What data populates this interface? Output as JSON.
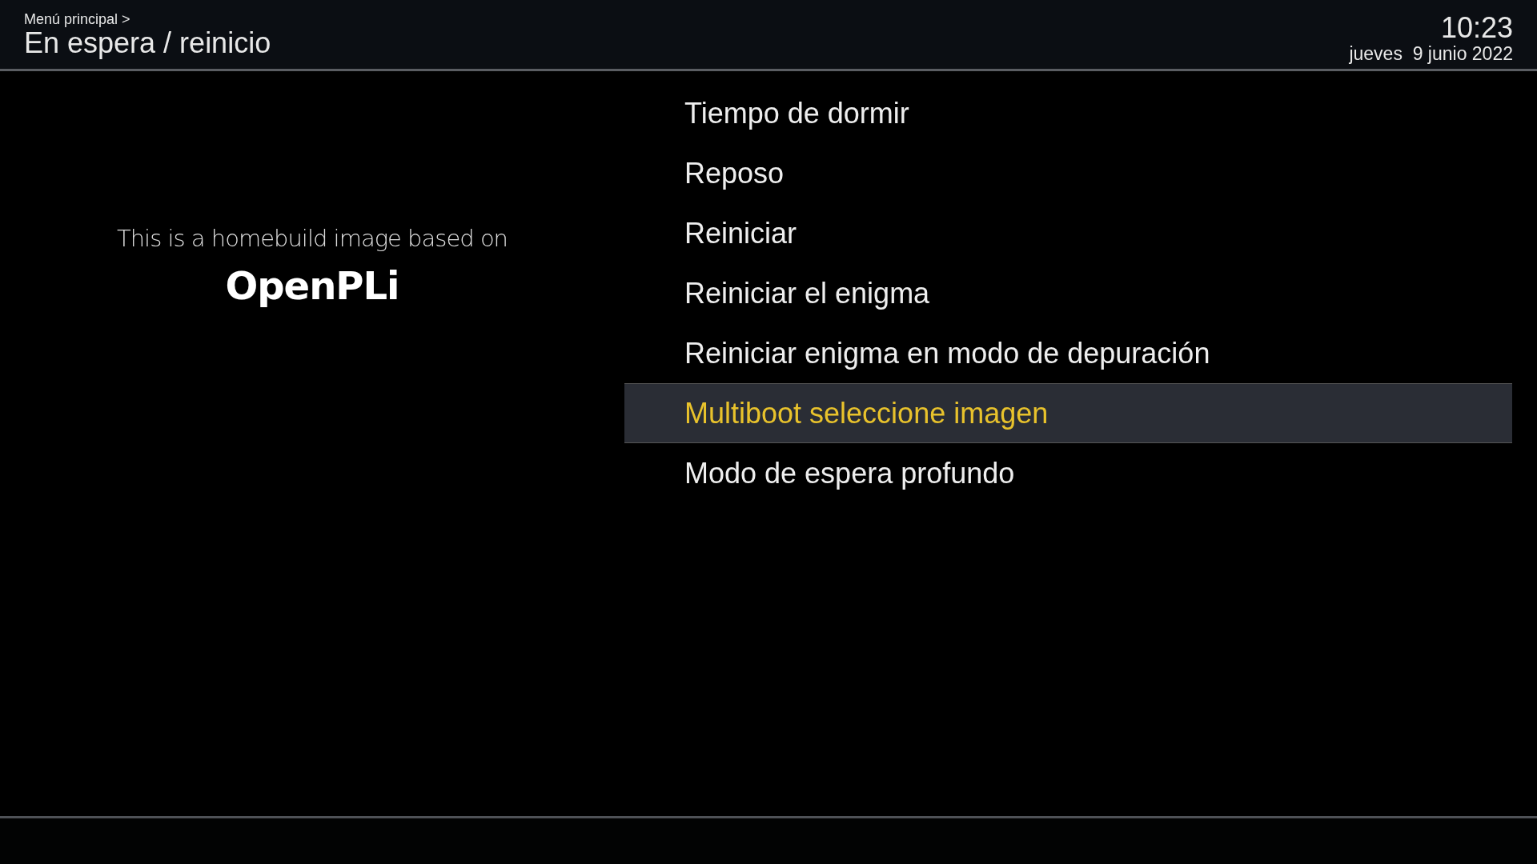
{
  "header": {
    "breadcrumb": "Menú principal >",
    "title": "En espera / reinicio",
    "time": "10:23",
    "date": "jueves  9 junio 2022"
  },
  "info": {
    "text": "This is a homebuild image based on",
    "logo": "OpenPLi"
  },
  "menu": [
    {
      "label": "Tiempo de dormir",
      "selected": false
    },
    {
      "label": "Reposo",
      "selected": false
    },
    {
      "label": "Reiniciar",
      "selected": false
    },
    {
      "label": "Reiniciar el enigma",
      "selected": false
    },
    {
      "label": "Reiniciar enigma en modo de depuración",
      "selected": false
    },
    {
      "label": "Multiboot seleccione imagen",
      "selected": true
    },
    {
      "label": "Modo de espera profundo",
      "selected": false
    }
  ]
}
